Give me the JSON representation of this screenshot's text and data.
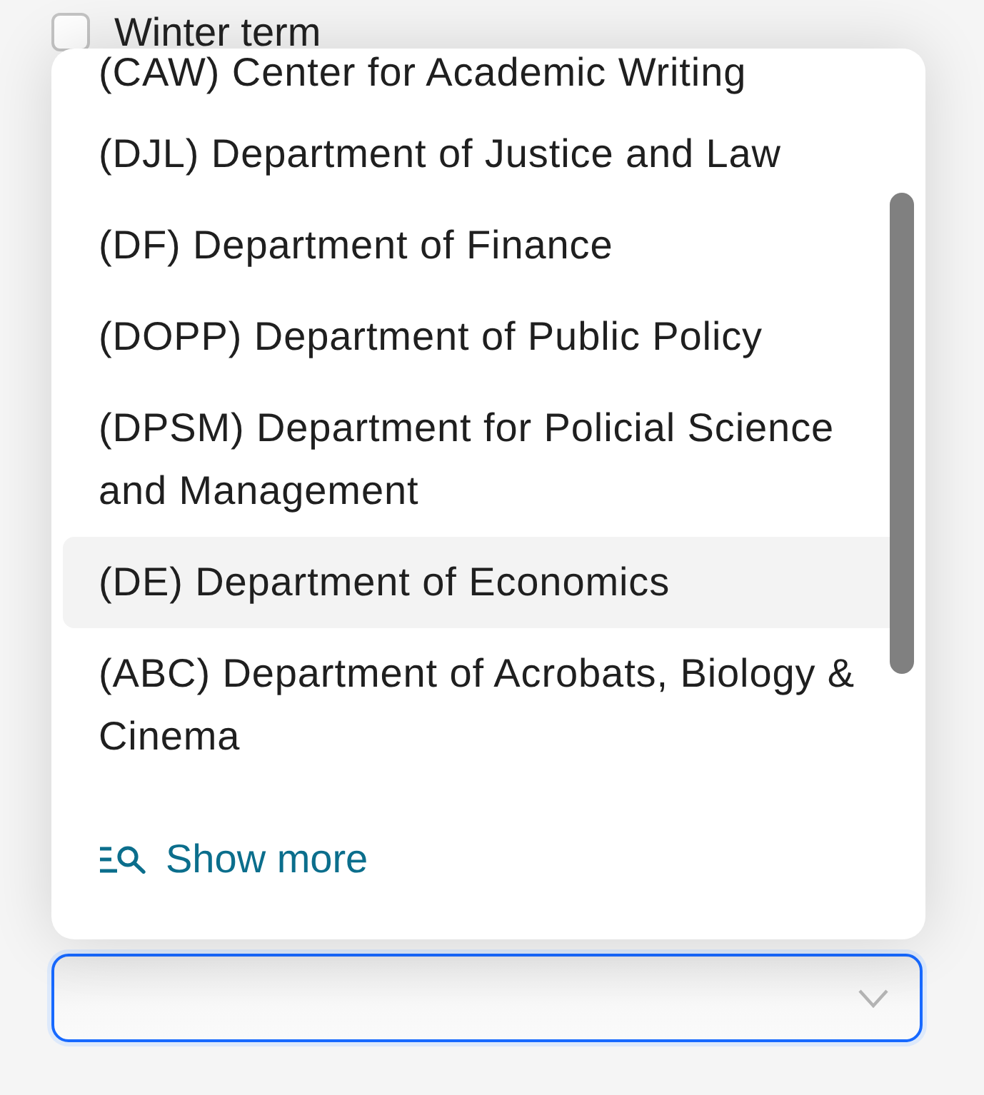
{
  "filter": {
    "label": "Winter term",
    "checked": false
  },
  "dropdown": {
    "options": [
      {
        "label": "(CAW) Center for Academic Writing",
        "selected": false
      },
      {
        "label": "(DJL) Department of Justice and Law",
        "selected": false
      },
      {
        "label": "(DF) Department of Finance",
        "selected": false
      },
      {
        "label": "(DOPP) Department of Public Policy",
        "selected": false
      },
      {
        "label": "(DPSM) Department for Policial Science and Management",
        "selected": false
      },
      {
        "label": "(DE) Department of Economics",
        "selected": true
      },
      {
        "label": "(ABC) Department of Acrobats, Biology & Cinema",
        "selected": false
      }
    ],
    "show_more": "Show more"
  },
  "select": {
    "focused": true
  }
}
